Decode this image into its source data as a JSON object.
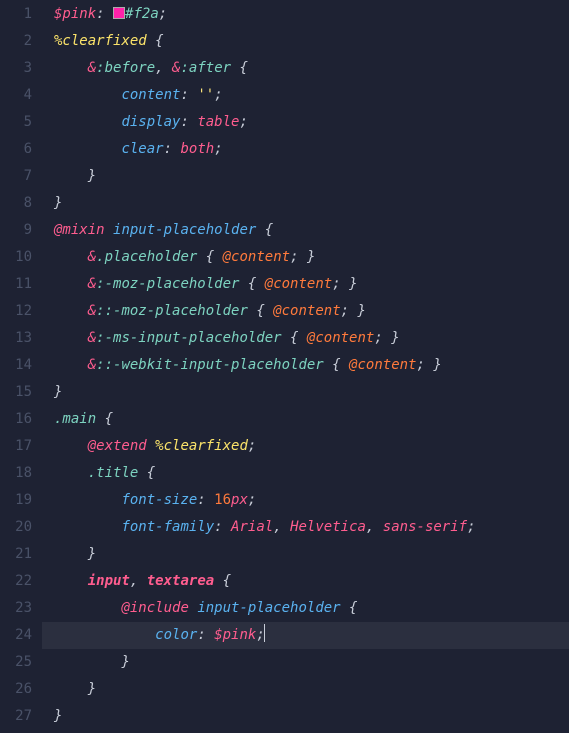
{
  "lines": [
    "1",
    "2",
    "3",
    "4",
    "5",
    "6",
    "7",
    "8",
    "9",
    "10",
    "11",
    "12",
    "13",
    "14",
    "15",
    "16",
    "17",
    "18",
    "19",
    "20",
    "21",
    "22",
    "23",
    "24",
    "25",
    "26",
    "27"
  ],
  "t": {
    "pinkVar": "$pink",
    "colon": ":",
    "space": " ",
    "hex": "#f2a",
    "semi": ";",
    "clearfixed": "%clearfixed",
    "lbrace": "{",
    "rbrace": "}",
    "amp": "&",
    "before": ":before",
    "after": ":after",
    "comma": ",",
    "content": "content",
    "emptystr": "''",
    "display": "display",
    "table": "table",
    "clear": "clear",
    "both": "both",
    "mixin": "@mixin",
    "ip": "input-placeholder",
    "dotPlaceholder": ".placeholder",
    "atcontent": "@content",
    "mozPh": ":-moz-placeholder",
    "dmozPh": "::-moz-placeholder",
    "msPh": ":-ms-input-placeholder",
    "wkPh": "::-webkit-input-placeholder",
    "main": ".main",
    "extend": "@extend",
    "title": ".title",
    "fontSize": "font-size",
    "sixteen": "16",
    "px": "px",
    "fontFamily": "font-family",
    "arial": "Arial",
    "helvetica": "Helvetica",
    "sans": "sans-serif",
    "input": "input",
    "textarea": "textarea",
    "include": "@include",
    "colorProp": "color"
  },
  "swatch": "#ff22aa"
}
